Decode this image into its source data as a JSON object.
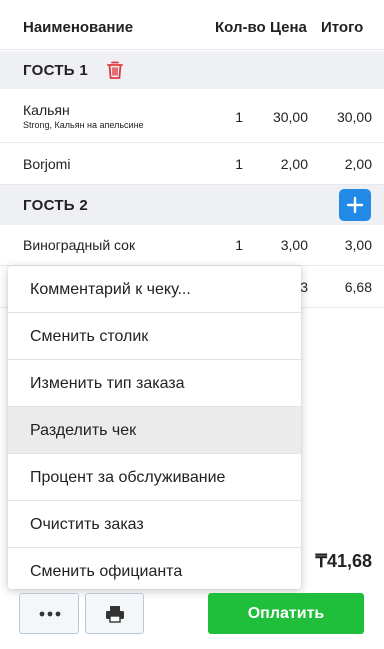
{
  "header": {
    "name": "Наименование",
    "qty": "Кол-во",
    "price": "Цена",
    "total": "Итого"
  },
  "guests": [
    {
      "label": "ГОСТЬ 1",
      "items": [
        {
          "name": "Кальян",
          "note": "Strong, Кальян на апельсине",
          "qty": "1",
          "price": "30,00",
          "total": "30,00"
        },
        {
          "name": "Borjomi",
          "qty": "1",
          "price": "2,00",
          "total": "2,00"
        }
      ]
    },
    {
      "label": "ГОСТЬ 2",
      "items": [
        {
          "name": "Виноградный сок",
          "qty": "1",
          "price": "3,00",
          "total": "3,00"
        },
        {
          "name": "",
          "qty": "",
          "price": "3",
          "total": "6,68"
        }
      ]
    }
  ],
  "grand_total": "₸41,68",
  "menu": {
    "items": [
      "Комментарий к чеку...",
      "Сменить столик",
      "Изменить тип заказа",
      "Разделить чек",
      "Процент за обслуживание",
      "Очистить заказ",
      "Сменить официанта"
    ],
    "highlighted_index": 3
  },
  "footer": {
    "pay_label": "Оплатить",
    "more_icon": "more-dots-icon",
    "print_icon": "printer-icon"
  },
  "colors": {
    "accent_blue": "#2389e6",
    "trash_red": "#e0393e",
    "pay_green": "#1fbe3b",
    "guest_bg": "#eef0f4"
  }
}
